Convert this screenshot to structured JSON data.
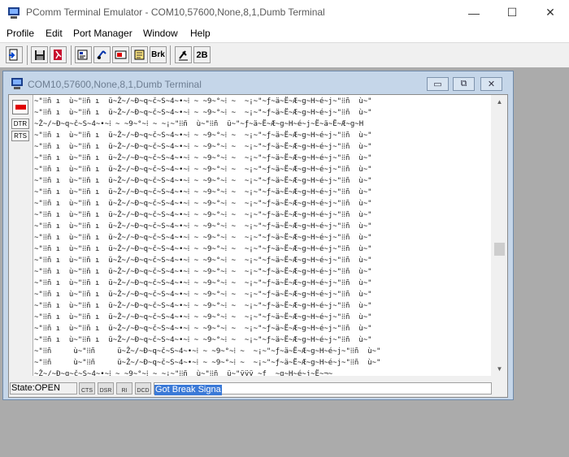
{
  "app": {
    "title": "PComm Terminal Emulator - COM10,57600,None,8,1,Dumb Terminal",
    "window_controls": {
      "minimize": "—",
      "maximize": "☐",
      "close": "✕"
    }
  },
  "menu": [
    "Profile",
    "Edit",
    "Port Manager",
    "Window",
    "Help"
  ],
  "toolbar": {
    "buttons": [
      {
        "name": "connect",
        "icon": "exit-arrow-icon"
      },
      {
        "name": "save",
        "icon": "floppy-disk-icon"
      },
      {
        "name": "exit",
        "icon": "exit-door-icon"
      },
      {
        "name": "properties",
        "icon": "properties-icon"
      },
      {
        "name": "transfer",
        "icon": "transfer-icon"
      },
      {
        "name": "capture",
        "icon": "capture-icon"
      },
      {
        "name": "script",
        "icon": "script-icon"
      },
      {
        "name": "break",
        "label": "Brk"
      },
      {
        "name": "signal",
        "icon": "signal-icon"
      },
      {
        "name": "speed",
        "label": "2B"
      }
    ]
  },
  "child": {
    "title": "COM10,57600,None,8,1,Dumb Terminal",
    "buttons": {
      "minimize": "▭",
      "restore": "⧉",
      "close": "✕"
    }
  },
  "side": {
    "dtr": "DTR",
    "rts": "RTS"
  },
  "terminal": {
    "lines": [
      "~\"⁞⁞ñ ı  ù~\"⁞⁞ñ ı  ü~Ž~/~Ð~q~č~S~4~•~⁞ ~ ~9~°~⁞ ~  ~¡~\"~ƒ~ä~Ë~Æ~g~H~é~j~\"⁞⁞ñ  ù~\"",
      "~\"⁞⁞ñ ı  ù~\"⁞⁞ñ ı  ü~Ž~/~Ð~q~č~S~4~•~⁞ ~ ~9~°~⁞ ~  ~¡~\"~ƒ~ä~Ë~Æ~g~H~é~j~\"⁞⁞ñ  ù~\"",
      "~Ž~/~Ð~q~č~S~4~•~⁞ ~ ~9~°~⁞ ~ ~¡~\"⁞⁞ñ  ù~\"⁞⁞ñ  ü~\"~ƒ~ä~Ë~Æ~g~H~é~j~Ë~ä~Ë~Æ~g~H",
      "~\"⁞⁞ñ ı  ù~\"⁞⁞ñ ı  ü~Ž~/~Ð~q~č~S~4~•~⁞ ~ ~9~°~⁞ ~  ~¡~\"~ƒ~ä~Ë~Æ~g~H~é~j~\"⁞⁞ñ  ù~\"",
      "~\"⁞⁞ñ ı  ù~\"⁞⁞ñ ı  ü~Ž~/~Ð~q~č~S~4~•~⁞ ~ ~9~°~⁞ ~  ~¡~\"~ƒ~ä~Ë~Æ~g~H~é~j~\"⁞⁞ñ  ù~\"",
      "~\"⁞⁞ñ ı  ù~\"⁞⁞ñ ı  ü~Ž~/~Ð~q~č~S~4~•~⁞ ~ ~9~°~⁞ ~  ~¡~\"~ƒ~ä~Ë~Æ~g~H~é~j~\"⁞⁞ñ  ù~\"",
      "~\"⁞⁞ñ ı  ù~\"⁞⁞ñ ı  ü~Ž~/~Ð~q~č~S~4~•~⁞ ~ ~9~°~⁞ ~  ~¡~\"~ƒ~ä~Ë~Æ~g~H~é~j~\"⁞⁞ñ  ù~\"",
      "~\"⁞⁞ñ ı  ù~\"⁞⁞ñ ı  ü~Ž~/~Ð~q~č~S~4~•~⁞ ~ ~9~°~⁞ ~  ~¡~\"~ƒ~ä~Ë~Æ~g~H~é~j~\"⁞⁞ñ  ù~\"",
      "~\"⁞⁞ñ ı  ù~\"⁞⁞ñ ı  ü~Ž~/~Ð~q~č~S~4~•~⁞ ~ ~9~°~⁞ ~  ~¡~\"~ƒ~ä~Ë~Æ~g~H~é~j~\"⁞⁞ñ  ù~\"",
      "~\"⁞⁞ñ ı  ù~\"⁞⁞ñ ı  ü~Ž~/~Ð~q~č~S~4~•~⁞ ~ ~9~°~⁞ ~  ~¡~\"~ƒ~ä~Ë~Æ~g~H~é~j~\"⁞⁞ñ  ù~\"",
      "~\"⁞⁞ñ ı  ù~\"⁞⁞ñ ı  ü~Ž~/~Ð~q~č~S~4~•~⁞ ~ ~9~°~⁞ ~  ~¡~\"~ƒ~ä~Ë~Æ~g~H~é~j~\"⁞⁞ñ  ù~\"",
      "~\"⁞⁞ñ ı  ù~\"⁞⁞ñ ı  ü~Ž~/~Ð~q~č~S~4~•~⁞ ~ ~9~°~⁞ ~  ~¡~\"~ƒ~ä~Ë~Æ~g~H~é~j~\"⁞⁞ñ  ù~\"",
      "~\"⁞⁞ñ ı  ù~\"⁞⁞ñ ı  ü~Ž~/~Ð~q~č~S~4~•~⁞ ~ ~9~°~⁞ ~  ~¡~\"~ƒ~ä~Ë~Æ~g~H~é~j~\"⁞⁞ñ  ù~\"",
      "~\"⁞⁞ñ ı  ù~\"⁞⁞ñ ı  ü~Ž~/~Ð~q~č~S~4~•~⁞ ~ ~9~°~⁞ ~  ~¡~\"~ƒ~ä~Ë~Æ~g~H~é~j~\"⁞⁞ñ  ù~\"",
      "~\"⁞⁞ñ ı  ù~\"⁞⁞ñ ı  ü~Ž~/~Ð~q~č~S~4~•~⁞ ~ ~9~°~⁞ ~  ~¡~\"~ƒ~ä~Ë~Æ~g~H~é~j~\"⁞⁞ñ  ù~\"",
      "~\"⁞⁞ñ ı  ù~\"⁞⁞ñ ı  ü~Ž~/~Ð~q~č~S~4~•~⁞ ~ ~9~°~⁞ ~  ~¡~\"~ƒ~ä~Ë~Æ~g~H~é~j~\"⁞⁞ñ  ù~\"",
      "~\"⁞⁞ñ ı  ù~\"⁞⁞ñ ı  ü~Ž~/~Ð~q~č~S~4~•~⁞ ~ ~9~°~⁞ ~  ~¡~\"~ƒ~ä~Ë~Æ~g~H~é~j~\"⁞⁞ñ  ù~\"",
      "~\"⁞⁞ñ ı  ù~\"⁞⁞ñ ı  ü~Ž~/~Ð~q~č~S~4~•~⁞ ~ ~9~°~⁞ ~  ~¡~\"~ƒ~ä~Ë~Æ~g~H~é~j~\"⁞⁞ñ  ù~\"",
      "~\"⁞⁞ñ ı  ù~\"⁞⁞ñ ı  ü~Ž~/~Ð~q~č~S~4~•~⁞ ~ ~9~°~⁞ ~  ~¡~\"~ƒ~ä~Ë~Æ~g~H~é~j~\"⁞⁞ñ  ù~\"",
      "~\"⁞⁞ñ ı  ù~\"⁞⁞ñ ı  ü~Ž~/~Ð~q~č~S~4~•~⁞ ~ ~9~°~⁞ ~  ~¡~\"~ƒ~ä~Ë~Æ~g~H~é~j~\"⁞⁞ñ  ù~\"",
      "~\"⁞⁞ñ ı  ù~\"⁞⁞ñ ı  ü~Ž~/~Ð~q~č~S~4~•~⁞ ~ ~9~°~⁞ ~  ~¡~\"~ƒ~ä~Ë~Æ~g~H~é~j~\"⁞⁞ñ  ù~\"",
      "~\"⁞⁞ñ ı  ù~\"⁞⁞ñ ı  ü~Ž~/~Ð~q~č~S~4~•~⁞ ~ ~9~°~⁞ ~  ~¡~\"~ƒ~ä~Ë~Æ~g~H~é~j~\"⁞⁞ñ  ù~\"",
      "~\"⁞⁞ñ     ù~\"⁞⁞ñ     ü~Ž~/~Ð~q~č~S~4~•~⁞ ~ ~9~°~⁞ ~  ~¡~\"~ƒ~ä~Ë~Æ~g~H~é~j~\"⁞⁞ñ  ù~\"",
      "~\"⁞⁞ñ     ù~\"⁞⁞ñ     ü~Ž~/~Ð~q~č~S~4~•~⁞ ~ ~9~°~⁞ ~  ~¡~\"~ƒ~ä~Ë~Æ~g~H~é~j~\"⁞⁞ñ  ù~\"",
      "~Ž~/~Ð~q~č~S~4~•~⁞ ~ ~9~°~⁞ ~ ~¡~\"⁞⁞ñ  ù~\"⁞⁞ñ  ü~\"ÿÿÿ ~ƒ  ~g~H~é~j~Ë~¬~"
    ]
  },
  "status": {
    "state": "State:OPEN",
    "leds": [
      "CTS",
      "DSR",
      "RI",
      "DCD"
    ],
    "message": "Got Break Signa"
  }
}
